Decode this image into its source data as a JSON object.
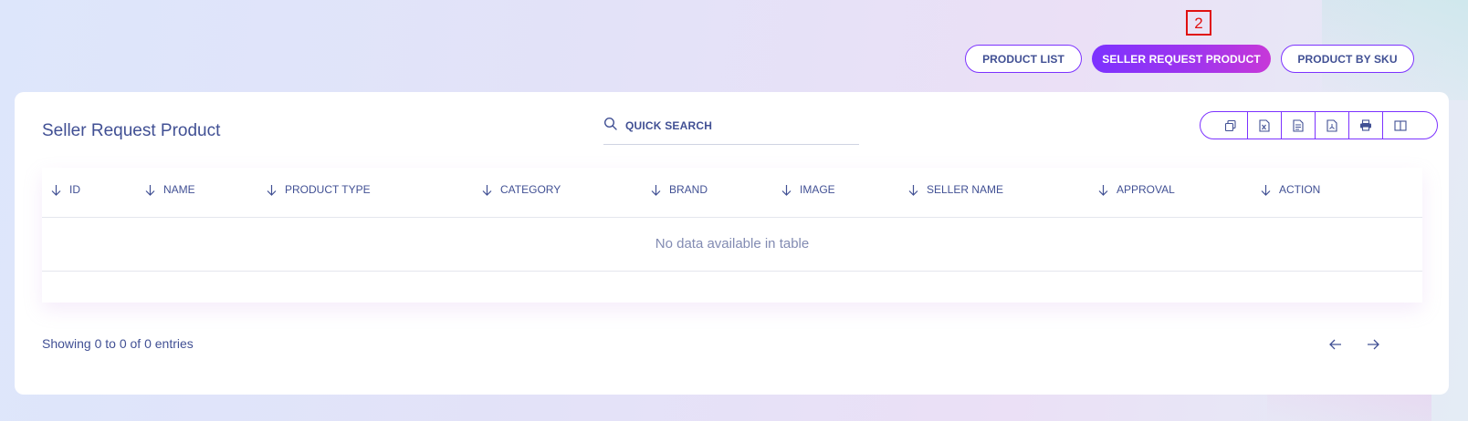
{
  "step_marker": "2",
  "tabs": [
    {
      "label": "PRODUCT LIST",
      "active": false
    },
    {
      "label": "SELLER REQUEST PRODUCT",
      "active": true
    },
    {
      "label": "PRODUCT BY SKU",
      "active": false
    }
  ],
  "card": {
    "title": "Seller Request Product",
    "search_placeholder": "QUICK SEARCH",
    "export_buttons": [
      "copy-icon",
      "excel-icon",
      "csv-icon",
      "pdf-icon",
      "print-icon",
      "columns-icon"
    ]
  },
  "table": {
    "columns": [
      "ID",
      "NAME",
      "PRODUCT TYPE",
      "CATEGORY",
      "BRAND",
      "IMAGE",
      "SELLER NAME",
      "APPROVAL",
      "ACTION"
    ],
    "empty_message": "No data available in table"
  },
  "footer": {
    "info": "Showing 0 to 0 of 0 entries"
  },
  "colors": {
    "accent": "#7c32ff",
    "text": "#415094",
    "muted": "#828bb2"
  }
}
